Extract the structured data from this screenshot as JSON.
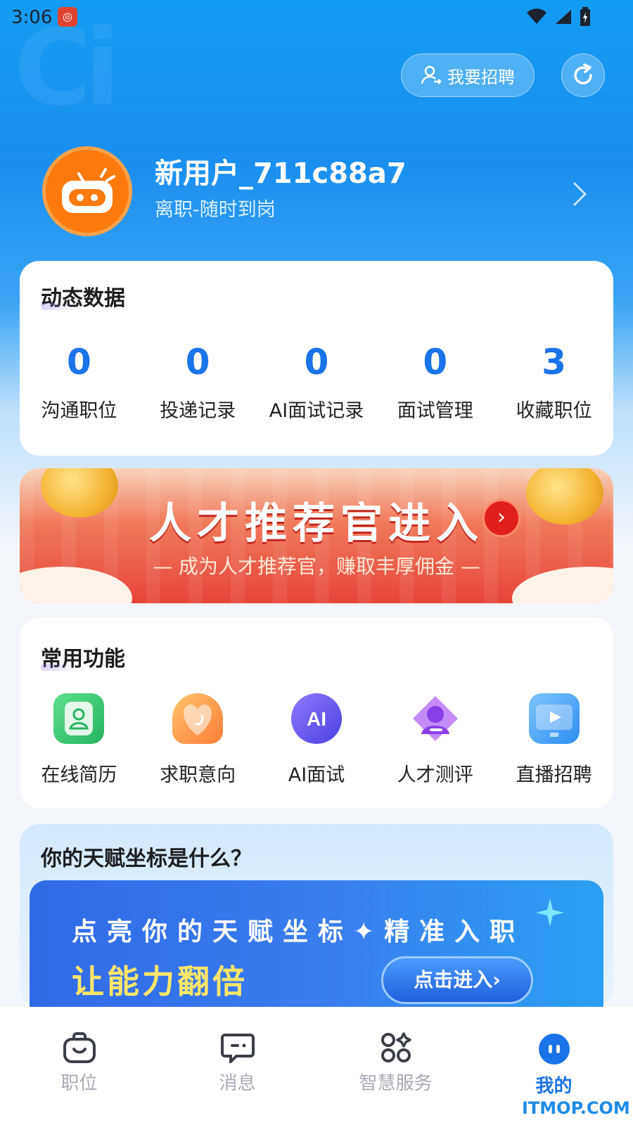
{
  "status_bar": {
    "time": "3:06"
  },
  "header": {
    "recruit_button": "我要招聘"
  },
  "profile": {
    "username": "新用户_711c88a7",
    "job_status": "离职-随时到岗"
  },
  "dynamic_data": {
    "title": "动态数据",
    "stats": [
      {
        "value": "0",
        "label": "沟通职位"
      },
      {
        "value": "0",
        "label": "投递记录"
      },
      {
        "value": "0",
        "label": "AI面试记录"
      },
      {
        "value": "0",
        "label": "面试管理"
      },
      {
        "value": "3",
        "label": "收藏职位"
      }
    ]
  },
  "promo_banner": {
    "title": "人才推荐官进入",
    "subtitle": "— 成为人才推荐官，赚取丰厚佣金 —"
  },
  "common_functions": {
    "title": "常用功能",
    "items": [
      {
        "label": "在线简历",
        "icon": "resume-icon",
        "color": "#2fc46b"
      },
      {
        "label": "求职意向",
        "icon": "heart-icon",
        "color": "#ff8a3d"
      },
      {
        "label": "AI面试",
        "icon": "ai-icon",
        "color": "#6b5cf5"
      },
      {
        "label": "人才测评",
        "icon": "person-assessment-icon",
        "color": "#a35cf0"
      },
      {
        "label": "直播招聘",
        "icon": "live-video-icon",
        "color": "#3aa0f5"
      }
    ]
  },
  "talent": {
    "title": "你的天赋坐标是什么？",
    "line1": "点亮你的天赋坐标✦精准入职",
    "line2": "让能力翻倍",
    "cta": "点击进入›"
  },
  "bottom_nav": {
    "items": [
      {
        "label": "职位",
        "icon": "briefcase-icon"
      },
      {
        "label": "消息",
        "icon": "message-icon"
      },
      {
        "label": "智慧服务",
        "icon": "apps-icon"
      },
      {
        "label": "我的",
        "icon": "profile-icon",
        "active": true
      }
    ]
  },
  "watermark": "ITMOP.COM",
  "colors": {
    "primary": "#1a73e8",
    "hero": "#139cf3",
    "avatar": "#ff7a0d"
  }
}
